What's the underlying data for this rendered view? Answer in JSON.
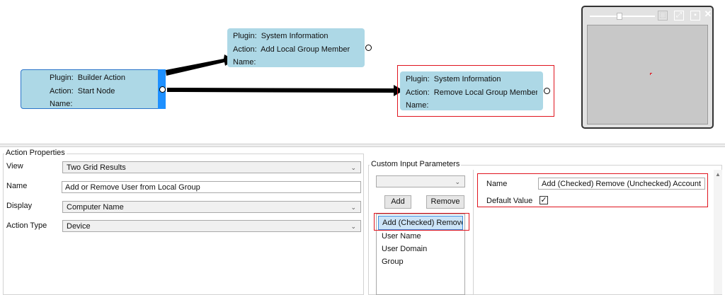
{
  "nodes": [
    {
      "plugin_label": "Plugin:",
      "plugin": "Builder Action",
      "action_label": "Action:",
      "action": "Start Node",
      "name_label": "Name:",
      "name": ""
    },
    {
      "plugin_label": "Plugin:",
      "plugin": "System Information",
      "action_label": "Action:",
      "action": "Add Local Group Member",
      "name_label": "Name:",
      "name": ""
    },
    {
      "plugin_label": "Plugin:",
      "plugin": "System Information",
      "action_label": "Action:",
      "action": "Remove Local Group Member",
      "name_label": "Name:",
      "name": ""
    }
  ],
  "minimap": {
    "buttons": [
      "⬚",
      "⤢",
      "▪",
      "✕"
    ]
  },
  "action_properties": {
    "title": "Action Properties",
    "view_label": "View",
    "view_value": "Two Grid Results",
    "name_label": "Name",
    "name_value": "Add or Remove User from Local Group",
    "display_label": "Display",
    "display_value": "Computer Name",
    "action_type_label": "Action Type",
    "action_type_value": "Device"
  },
  "custom_input": {
    "title": "Custom Input Parameters",
    "dropdown_value": "",
    "add_label": "Add",
    "remove_label": "Remove",
    "items": [
      "Add (Checked) Remove (Unchecked) Account",
      "User Name",
      "User Domain",
      "Group"
    ],
    "param_name_label": "Name",
    "param_name_value": "Add (Checked) Remove (Unchecked) Account",
    "default_value_label": "Default Value",
    "default_checked": "✓"
  },
  "icons": {
    "chevron": "chevron-down-icon",
    "scroll_up": "scroll-up-icon"
  }
}
